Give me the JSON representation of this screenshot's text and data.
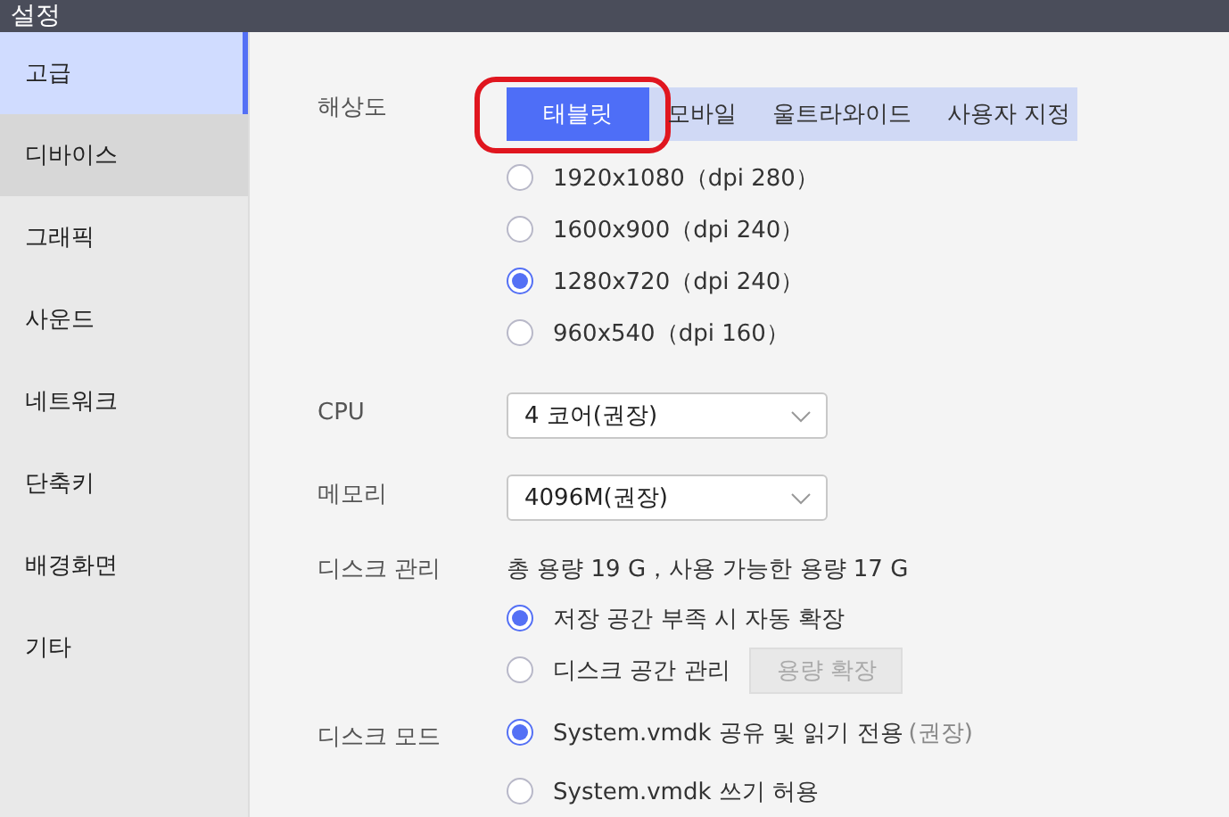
{
  "window": {
    "title": "설정"
  },
  "sidebar": {
    "items": [
      {
        "label": "고급",
        "selected": true,
        "hovered": false
      },
      {
        "label": "디바이스",
        "selected": false,
        "hovered": true
      },
      {
        "label": "그래픽",
        "selected": false,
        "hovered": false
      },
      {
        "label": "사운드",
        "selected": false,
        "hovered": false
      },
      {
        "label": "네트워크",
        "selected": false,
        "hovered": false
      },
      {
        "label": "단축키",
        "selected": false,
        "hovered": false
      },
      {
        "label": "배경화면",
        "selected": false,
        "hovered": false
      },
      {
        "label": "기타",
        "selected": false,
        "hovered": false
      }
    ]
  },
  "resolution": {
    "label": "해상도",
    "tabs": [
      {
        "label": "태블릿",
        "selected": true,
        "circled": true
      },
      {
        "label": "모바일",
        "selected": false,
        "circled": false
      },
      {
        "label": "울트라와이드",
        "selected": false,
        "circled": false
      },
      {
        "label": "사용자 지정",
        "selected": false,
        "circled": false
      }
    ],
    "options": [
      {
        "label": "1920x1080（dpi 280）",
        "selected": false
      },
      {
        "label": "1600x900（dpi 240）",
        "selected": false
      },
      {
        "label": "1280x720（dpi 240）",
        "selected": true
      },
      {
        "label": "960x540（dpi 160）",
        "selected": false
      }
    ]
  },
  "cpu": {
    "label": "CPU",
    "value": "4 코어(권장)"
  },
  "memory": {
    "label": "메모리",
    "value": "4096M(권장)"
  },
  "disk_management": {
    "label": "디스크 관리",
    "info": "총 용량 19 G，사용 가능한 용량 17 G",
    "options": [
      {
        "label": "저장 공간 부족 시 자동 확장",
        "selected": true
      },
      {
        "label": "디스크 공간 관리",
        "selected": false,
        "button": {
          "label": "용량 확장",
          "disabled": true
        }
      }
    ]
  },
  "disk_mode": {
    "label": "디스크 모드",
    "options": [
      {
        "label": "System.vmdk 공유 및 읽기 전용",
        "note": "(권장)",
        "selected": true
      },
      {
        "label": "System.vmdk 쓰기 허용",
        "selected": false
      }
    ]
  }
}
